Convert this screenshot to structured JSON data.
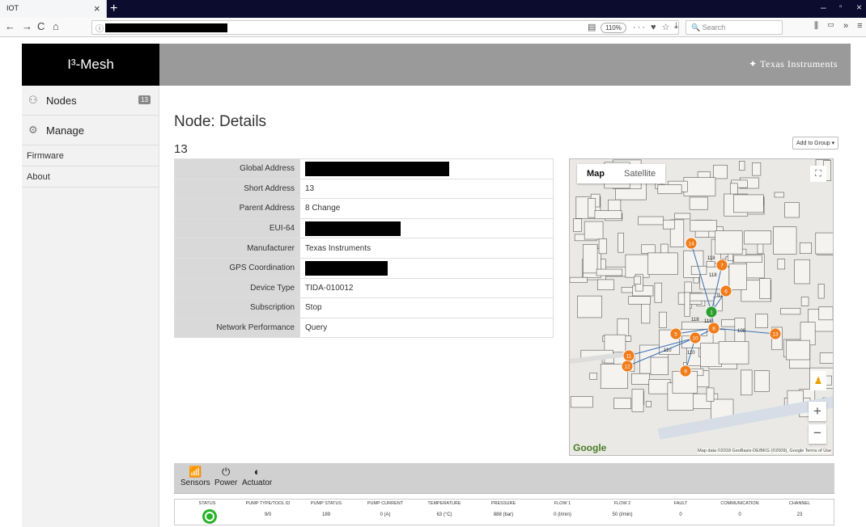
{
  "browser": {
    "tab_title": "IOT",
    "tab_close": "×",
    "new_tab": "+",
    "zoom": "110%",
    "search_placeholder": "Search",
    "page_actions": "··· ♥ ☆",
    "back": "←",
    "forward": "→",
    "reload": "C",
    "home": "⌂"
  },
  "app": {
    "brand": "I³-Mesh",
    "vendor_logo": "Texas Instruments"
  },
  "sidebar": {
    "items": [
      {
        "label": "Nodes",
        "icon": "nodes-icon",
        "badge": "13"
      },
      {
        "label": "Manage",
        "icon": "gear-icon"
      }
    ],
    "links": [
      "Firmware",
      "About"
    ]
  },
  "page": {
    "title": "Node: Details",
    "node_id": "13",
    "add_group": "Add to Group ▾"
  },
  "details": [
    {
      "key": "Global Address",
      "value": "",
      "redacted": true
    },
    {
      "key": "Short Address",
      "value": "13"
    },
    {
      "key": "Parent Address",
      "value": "8 Change"
    },
    {
      "key": "EUI-64",
      "value": "",
      "redacted": true
    },
    {
      "key": "Manufacturer",
      "value": "Texas Instruments"
    },
    {
      "key": "GPS Coordination",
      "value": "",
      "redacted": true
    },
    {
      "key": "Device Type",
      "value": "TIDA-010012"
    },
    {
      "key": "Subscription",
      "value": "Stop"
    },
    {
      "key": "Network Performance",
      "value": "Query"
    }
  ],
  "map": {
    "tab_map": "Map",
    "tab_satellite": "Satellite",
    "google": "Google",
    "attribution": "Map data ©2018 GeoBasis-DE/BKG (©2009), Google   Terms of Use",
    "root_color": "#2e9e2e",
    "node_color": "#f07c1a",
    "nodes": [
      {
        "id": "14"
      },
      {
        "id": "7"
      },
      {
        "id": "6"
      },
      {
        "id": "1"
      },
      {
        "id": "8"
      },
      {
        "id": "5"
      },
      {
        "id": "10"
      },
      {
        "id": "13"
      },
      {
        "id": "11"
      },
      {
        "id": "12"
      },
      {
        "id": "9"
      }
    ],
    "link_labels": [
      "118",
      "118",
      "109",
      "116",
      "118",
      "110",
      "110",
      "118"
    ]
  },
  "bottom_tabs": [
    {
      "label": "Sensors",
      "icon": "signal-icon"
    },
    {
      "label": "Power",
      "icon": "power-icon"
    },
    {
      "label": "Actuator",
      "icon": "toggle-icon"
    }
  ],
  "sensor_table": {
    "headers": [
      "STATUS",
      "PUMP TYPE/TOOL ID",
      "PUMP STATUS",
      "PUMP CURRENT",
      "TEMPERATURE",
      "PRESSURE",
      "FLOW 1",
      "FLOW 2",
      "FAULT",
      "COMMUNICATION",
      "CHANNEL"
    ],
    "values": [
      "",
      "9/0",
      "189",
      "0 (A)",
      "63 (°C)",
      "888 (bar)",
      "0 (l/min)",
      "50 (l/min)",
      "0",
      "0",
      "23"
    ],
    "status_color": "#27b227"
  }
}
